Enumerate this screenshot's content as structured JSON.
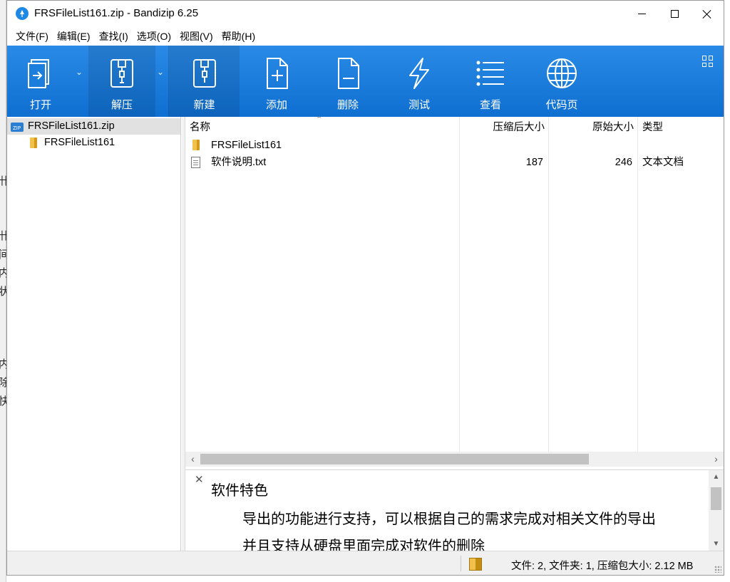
{
  "window": {
    "title": "FRSFileList161.zip - Bandizip 6.25"
  },
  "background_glyphs": [
    "卄",
    "卄",
    "间",
    "内",
    "状",
    "内",
    "除",
    "快"
  ],
  "menu": [
    "文件(F)",
    "编辑(E)",
    "查找(I)",
    "选项(O)",
    "视图(V)",
    "帮助(H)"
  ],
  "toolbar": {
    "open": "打开",
    "extract": "解压",
    "new": "新建",
    "add": "添加",
    "delete": "删除",
    "test": "测试",
    "view": "查看",
    "codepage": "代码页"
  },
  "tree": {
    "root": "FRSFileList161.zip",
    "child": "FRSFileList161"
  },
  "list": {
    "columns": {
      "name": "名称",
      "packed": "压缩后大小",
      "original": "原始大小",
      "type": "类型"
    },
    "rows": [
      {
        "name": "FRSFileList161",
        "packed": "",
        "original": "",
        "type": ""
      },
      {
        "name": "软件说明.txt",
        "packed": "187",
        "original": "246",
        "type": "文本文档"
      }
    ]
  },
  "description": {
    "title": "软件特色",
    "lines": [
      "导出的功能进行支持，可以根据自己的需求完成对相关文件的导出",
      "并且支持从硬盘里面完成对软件的删除"
    ]
  },
  "status": {
    "text": "文件: 2, 文件夹: 1, 压缩包大小: 2.12 MB"
  },
  "colors": {
    "toolbar": "#1b7ddc",
    "selection": "#e1e1e1",
    "folder": "#f2c14b"
  }
}
